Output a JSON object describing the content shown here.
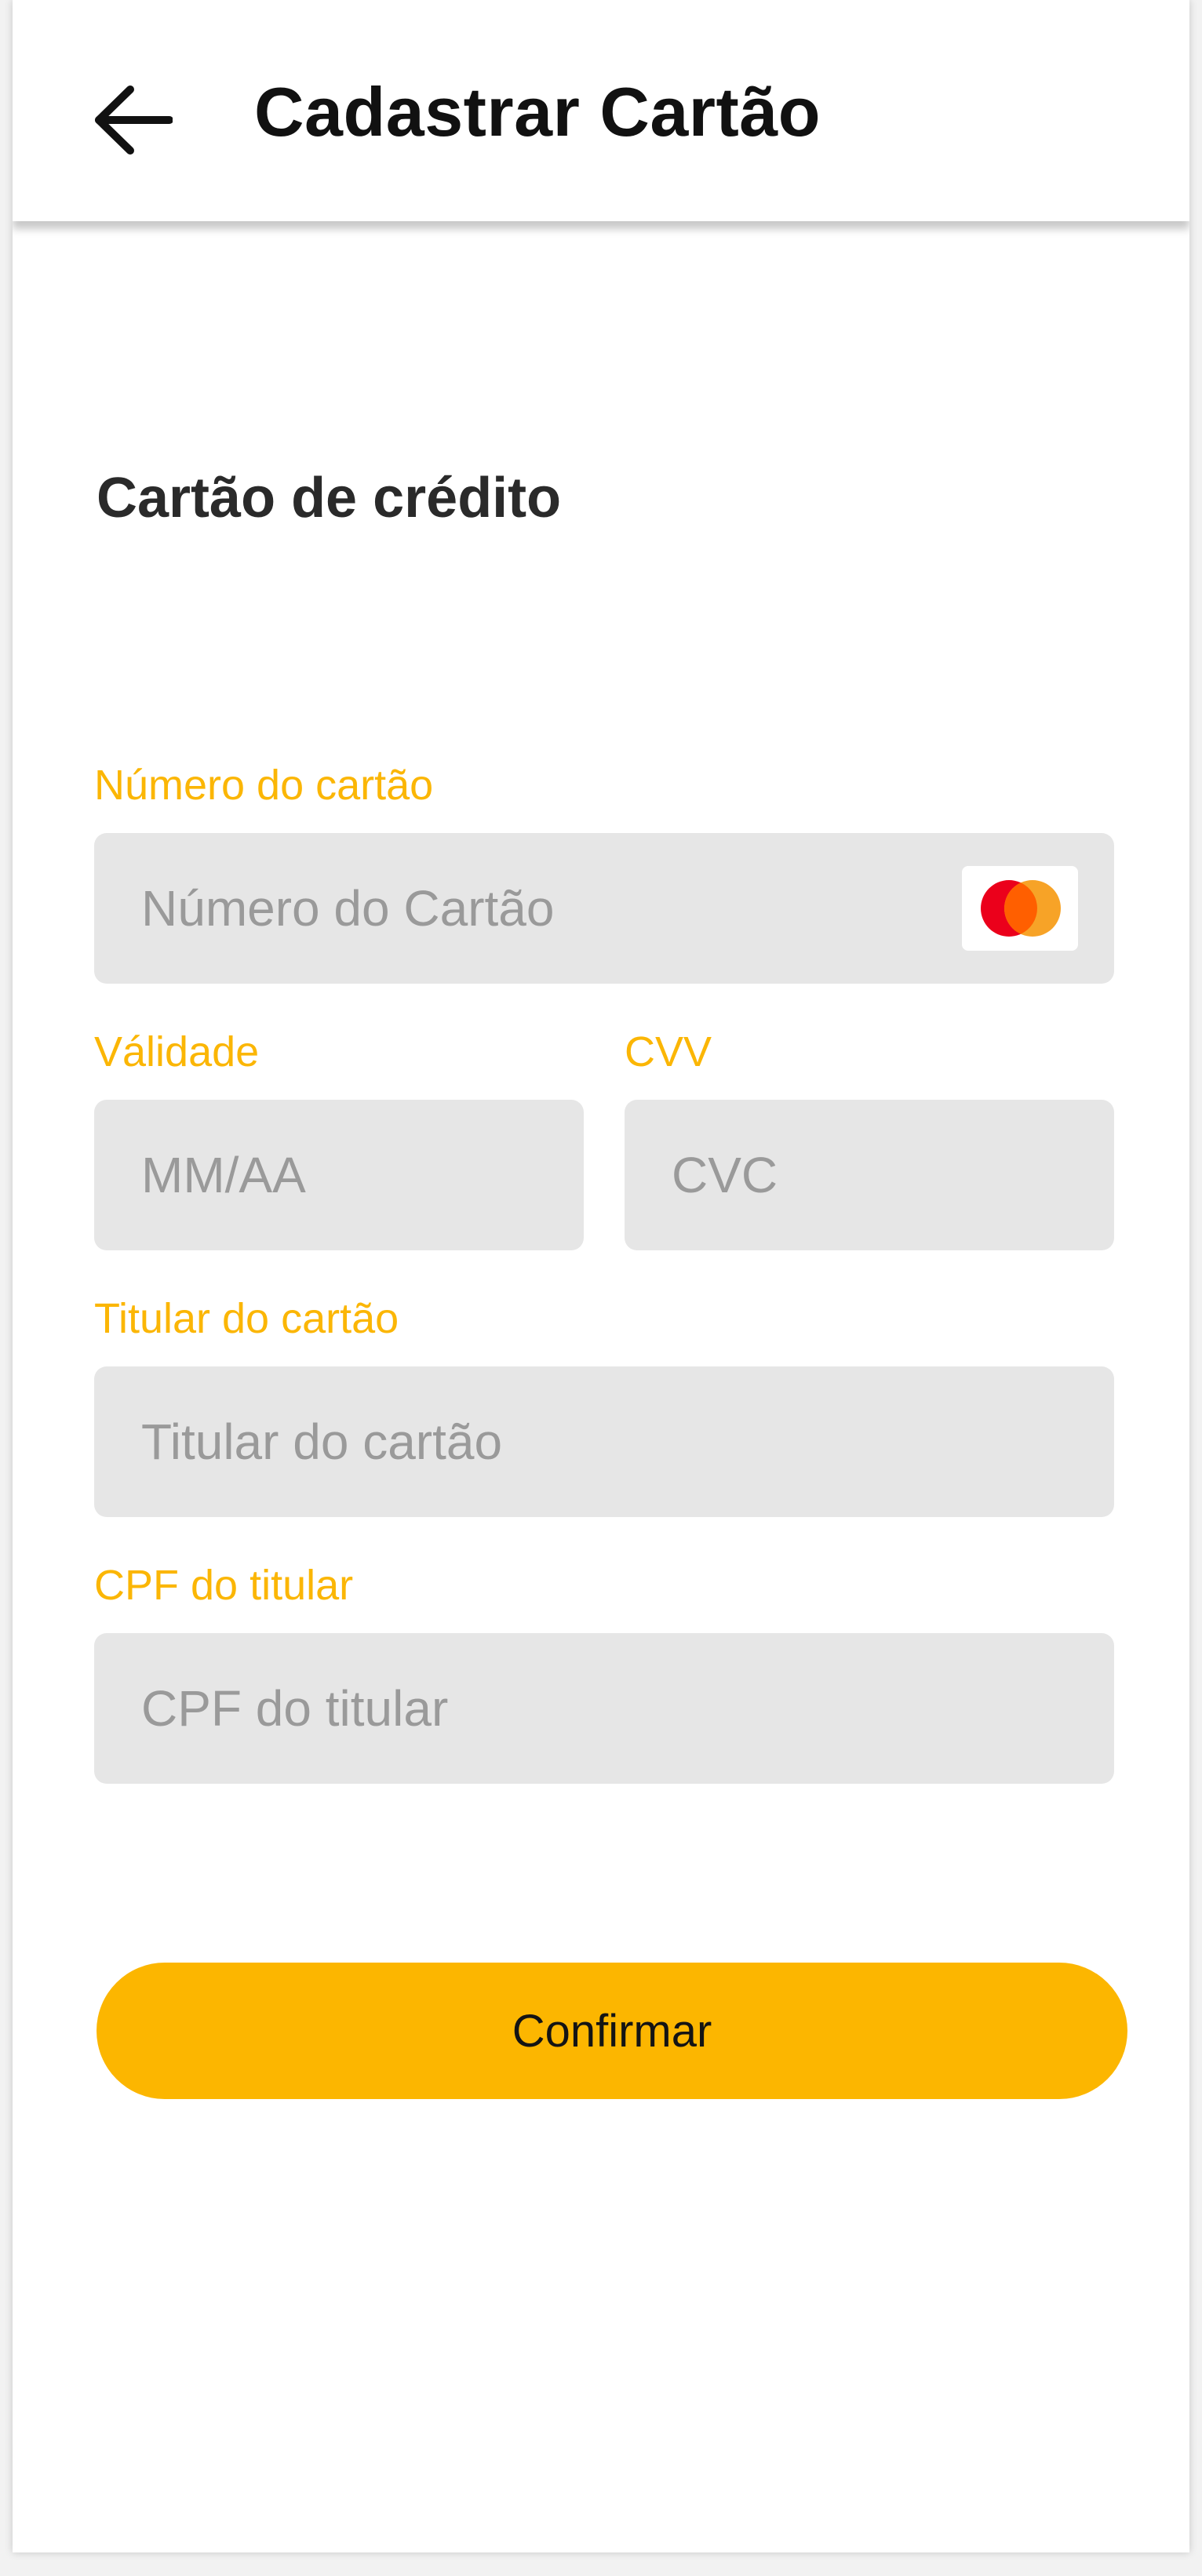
{
  "header": {
    "back_icon": "arrow-left-icon",
    "title": "Cadastrar Cartão"
  },
  "section": {
    "title": "Cartão de crédito"
  },
  "form": {
    "card_number": {
      "label": "Número do cartão",
      "placeholder": "Número do Cartão",
      "value": "",
      "brand_icon": "mastercard-icon"
    },
    "expiry": {
      "label": "Válidade",
      "placeholder": "MM/AA",
      "value": ""
    },
    "cvv": {
      "label": "CVV",
      "placeholder": "CVC",
      "value": ""
    },
    "holder": {
      "label": "Titular do cartão",
      "placeholder": "Titular do cartão",
      "value": ""
    },
    "cpf": {
      "label": "CPF do titular",
      "placeholder": "CPF do titular",
      "value": ""
    }
  },
  "actions": {
    "confirm_label": "Confirmar"
  },
  "colors": {
    "accent": "#fcb600",
    "label": "#fbb605",
    "field_bg": "#e6e6e6",
    "mastercard_red": "#eb001b",
    "mastercard_orange": "#f79e1b"
  }
}
